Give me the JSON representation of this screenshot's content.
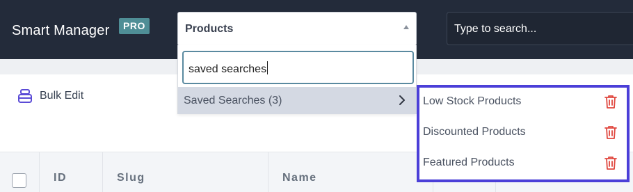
{
  "header": {
    "app_title": "Smart Manager",
    "badge": "PRO",
    "dashboard_select_value": "Products",
    "search_placeholder": "Type to search..."
  },
  "toolbar": {
    "bulk_edit_label": "Bulk Edit",
    "bulk_edit_icon": "stack-icon"
  },
  "table": {
    "columns": [
      "ID",
      "Slug",
      "Name"
    ]
  },
  "dropdown": {
    "search_value": "saved searches",
    "option_label": "Saved Searches (3)",
    "option_icon": "chevron-right-icon"
  },
  "saved_searches": {
    "items": [
      {
        "label": "Low Stock Products",
        "icon": "trash-icon"
      },
      {
        "label": "Discounted Products",
        "icon": "trash-icon"
      },
      {
        "label": "Featured Products",
        "icon": "trash-icon"
      }
    ]
  },
  "colors": {
    "header_bg": "#232b3a",
    "pro_badge": "#4f8e96",
    "highlight_border": "#4b3fd8",
    "delete_red": "#e0473f",
    "option_bg": "#d4d9e3"
  }
}
